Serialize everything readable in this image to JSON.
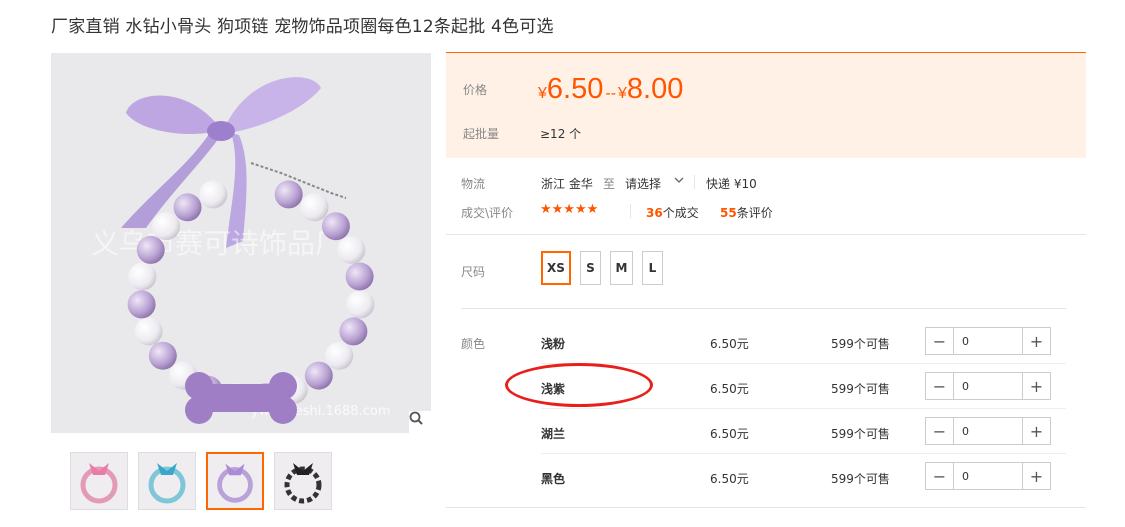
{
  "title": "厂家直销 水钻小骨头 狗项链 宠物饰品项圈每色12条起批 4色可选",
  "gallery": {
    "watermark": "义乌市赛可诗饰品厂",
    "url_watermark": "ywsaikeshi.1688.com",
    "thumbs": [
      "thumb-pink",
      "thumb-blue",
      "thumb-purple",
      "thumb-black"
    ]
  },
  "price": {
    "label": "价格",
    "currency": "¥",
    "low": "6.50",
    "range_sep": "--",
    "high": "8.00",
    "moq_label": "起批量",
    "moq_value": "≥12 个"
  },
  "logistics": {
    "label": "物流",
    "origin": "浙江 金华",
    "to": "至",
    "dest": "请选择",
    "shipping": "快递 ¥10"
  },
  "reviews": {
    "label": "成交\\评价",
    "stars": "★★★★★",
    "deals_count": "36",
    "deals_text": "个成交",
    "review_count": "55",
    "review_text": "条评价"
  },
  "size": {
    "label": "尺码",
    "options": [
      "XS",
      "S",
      "M",
      "L"
    ],
    "selected": "XS"
  },
  "color": {
    "label": "颜色",
    "rows": [
      {
        "name": "浅粉",
        "price": "6.50元",
        "stock": "599个可售",
        "qty": "0"
      },
      {
        "name": "浅紫",
        "price": "6.50元",
        "stock": "599个可售",
        "qty": "0"
      },
      {
        "name": "湖兰",
        "price": "6.50元",
        "stock": "599个可售",
        "qty": "0"
      },
      {
        "name": "黑色",
        "price": "6.50元",
        "stock": "599个可售",
        "qty": "0"
      }
    ]
  },
  "colors": {
    "accent": "#ff5500",
    "panel_bg": "#fff1e6",
    "highlight_circle": "#e8201c"
  }
}
